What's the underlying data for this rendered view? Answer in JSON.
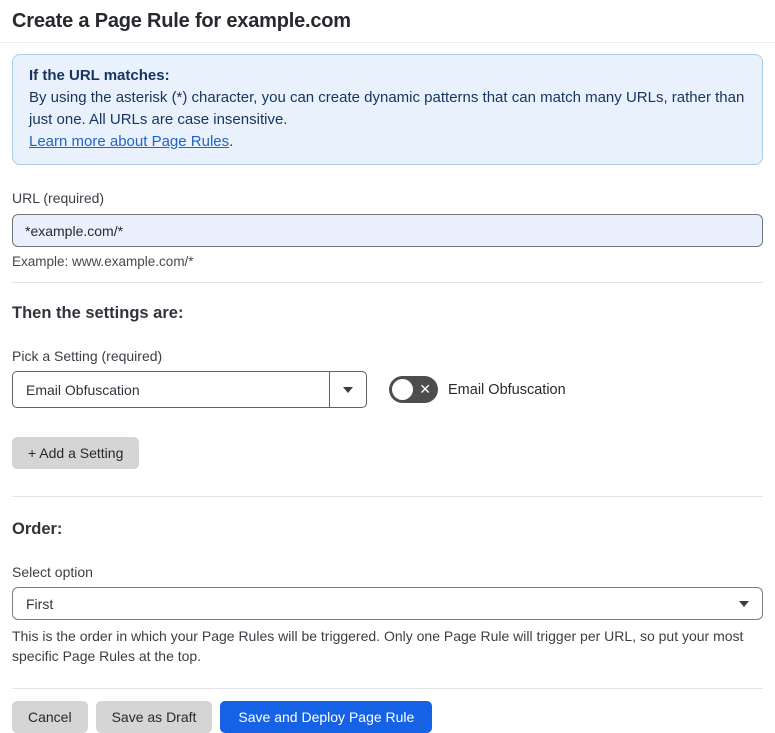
{
  "page": {
    "title": "Create a Page Rule for example.com"
  },
  "info_box": {
    "heading": "If the URL matches:",
    "body": "By using the asterisk (*) character, you can create dynamic patterns that can match many URLs, rather than just one. All URLs are case insensitive.",
    "link_text": "Learn more about Page Rules",
    "link_suffix": "."
  },
  "url_field": {
    "label": "URL (required)",
    "value": "*example.com/*",
    "example": "Example: www.example.com/*"
  },
  "settings_section": {
    "heading": "Then the settings are:",
    "pick_label": "Pick a Setting (required)",
    "selected_setting": "Email Obfuscation",
    "toggle_state": "off",
    "toggle_off_glyph": "✕",
    "toggle_label": "Email Obfuscation",
    "add_button_label": "+ Add a Setting"
  },
  "order_section": {
    "heading": "Order:",
    "select_label": "Select option",
    "selected_option": "First",
    "help_text": "This is the order in which your Page Rules will be triggered. Only one Page Rule will trigger per URL, so put your most specific Page Rules at the top."
  },
  "footer": {
    "cancel_label": "Cancel",
    "save_draft_label": "Save as Draft",
    "save_deploy_label": "Save and Deploy Page Rule"
  },
  "colors": {
    "info_bg": "#E9F2FC",
    "info_border": "#AECBEC",
    "info_text": "#17335F",
    "link_blue": "#2264C5",
    "url_input_bg": "#EAF0FB",
    "toggle_bg": "#4D4D4D",
    "gray_button_bg": "#D5D5D5",
    "primary_button_bg": "#1662E6"
  }
}
